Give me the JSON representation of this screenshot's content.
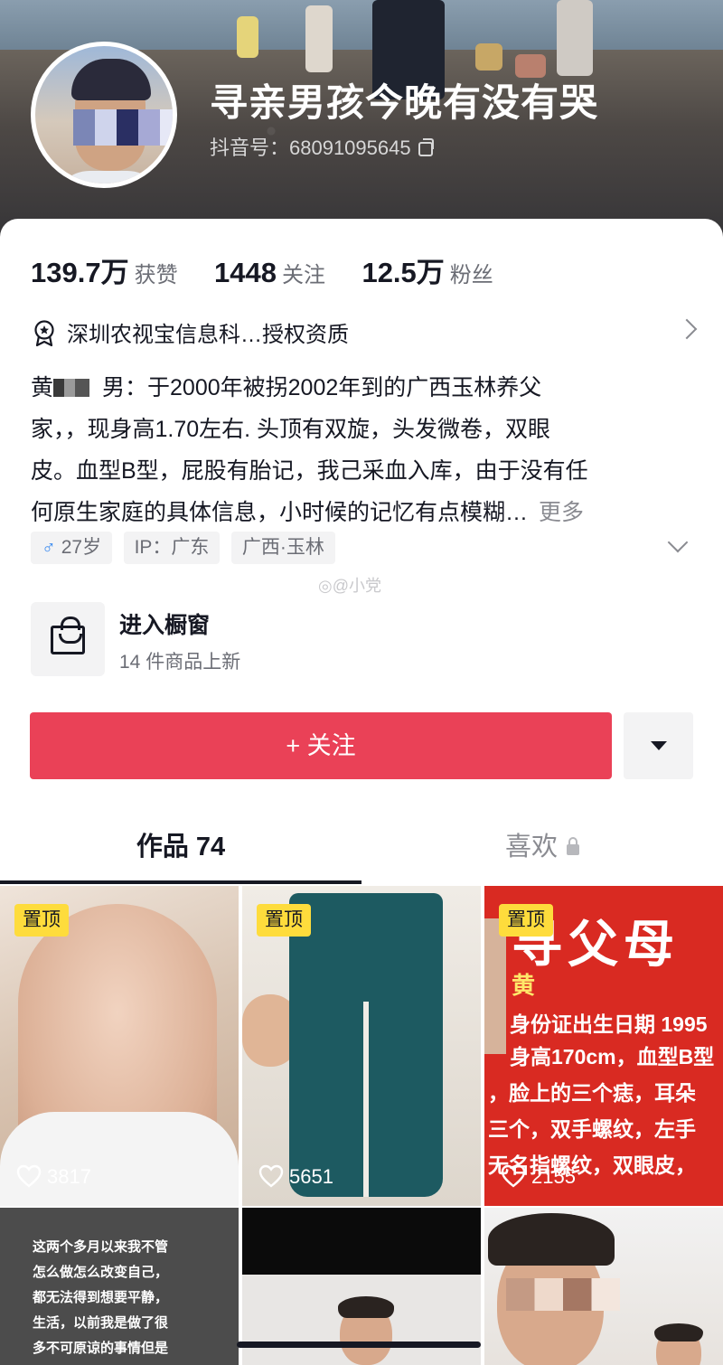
{
  "profile": {
    "nickname": "寻亲男孩今晚有没有哭",
    "douyin_id": "抖音号：68091095645"
  },
  "stats": [
    {
      "value": "139.7万",
      "label": "获赞"
    },
    {
      "value": "1448",
      "label": "关注"
    },
    {
      "value": "12.5万",
      "label": "粉丝"
    }
  ],
  "certification": "深圳农视宝信息科…授权资质",
  "bio": {
    "name_prefix": "黄",
    "line1_rest": "男：于2000年被拐2002年到的广西玉林养父",
    "line2": "家，，现身高1.70左右. 头顶有双旋，头发微卷，双眼",
    "line3": "皮。血型B型，屁股有胎记，我己采血入库，由于没有任",
    "line4": "何原生家庭的具体信息，小时候的记忆有点模糊…",
    "more": "更多"
  },
  "tags": {
    "gender_symbol": "♂",
    "age": "27岁",
    "ip": "IP：广东",
    "location": "广西·玉林"
  },
  "watermark": "@小党",
  "showcase": {
    "title": "进入橱窗",
    "subtitle": "14 件商品上新"
  },
  "follow_button": "+ 关注",
  "tabs": {
    "works": "作品 74",
    "likes": "喜欢"
  },
  "videos": [
    {
      "pinned": "置顶",
      "likes": "3817"
    },
    {
      "pinned": "置顶",
      "likes": "5651"
    },
    {
      "pinned": "置顶",
      "likes": "2155",
      "poster": {
        "title": "寻父母",
        "name": "黄",
        "lines": [
          "身份证出生日期 1995",
          "身高170cm，血型B型",
          "，脸上的三个痣，耳朵",
          "三个，双手螺纹，左手",
          "无名指螺纹，双眼皮，"
        ]
      }
    },
    {
      "text": [
        "这两个多月以来我不管",
        "怎么做怎么改变自己，",
        "都无法得到想要平静，",
        "生活，以前我是做了很",
        "多不可原谅的事情但是"
      ]
    },
    {},
    {}
  ],
  "colors": {
    "accent": "#ea4157",
    "pin_badge": "#fedc3c",
    "poster_red": "#d92a22"
  }
}
